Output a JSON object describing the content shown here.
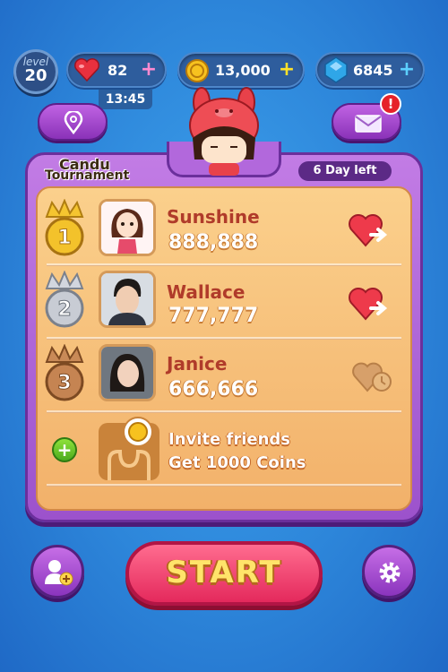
{
  "player": {
    "level_label": "level",
    "level": "20"
  },
  "resources": {
    "lives": "82",
    "coins": "13,000",
    "gems": "6845",
    "timer": "13:45"
  },
  "tournament": {
    "title_line1": "Candu",
    "title_line2": "Tournament",
    "days_left": "6 Day left"
  },
  "leaderboard": [
    {
      "rank": "1",
      "name": "Sunshine",
      "score": "888,888"
    },
    {
      "rank": "2",
      "name": "Wallace",
      "score": "777,777"
    },
    {
      "rank": "3",
      "name": "Janice",
      "score": "666,666"
    }
  ],
  "invite": {
    "line1": "Invite friends",
    "line2": "Get 1000 Coins"
  },
  "start_label": "START",
  "colors": {
    "background": "#2d86da",
    "panel": "#b268dc",
    "inner": "#f7c27c",
    "start": "#ee3d6c",
    "name": "#b03b2a"
  }
}
